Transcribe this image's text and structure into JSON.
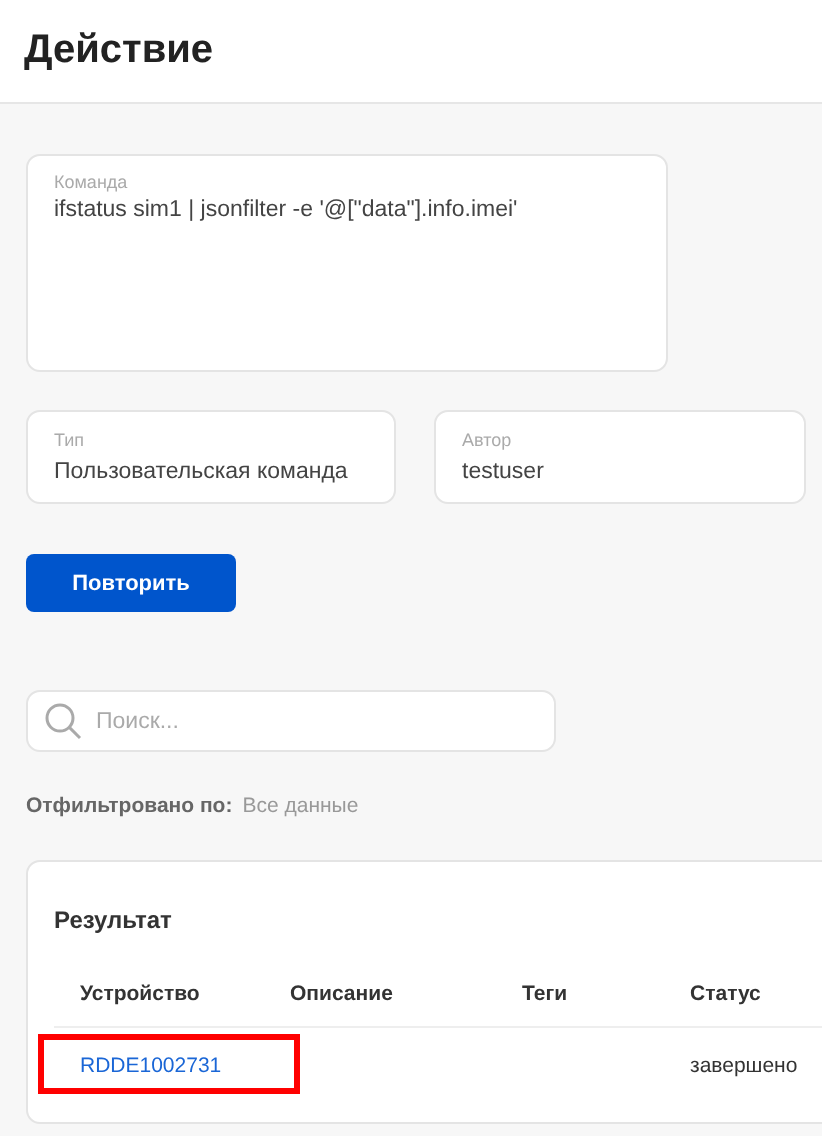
{
  "header": {
    "title": "Действие"
  },
  "command": {
    "label": "Команда",
    "value": "ifstatus sim1 | jsonfilter -e '@[\"data\"].info.imei'"
  },
  "fields": [
    {
      "label": "Тип",
      "value": "Пользовательская команда"
    },
    {
      "label": "Автор",
      "value": "testuser"
    }
  ],
  "repeat_button": "Повторить",
  "search": {
    "placeholder": "Поиск..."
  },
  "filter": {
    "label": "Отфильтровано по:",
    "value": "Все данные"
  },
  "result": {
    "title": "Результат",
    "columns": [
      "Устройство",
      "Описание",
      "Теги",
      "Статус"
    ],
    "rows": [
      {
        "device": "RDDE1002731",
        "description": "",
        "tags": "",
        "status": "завершено",
        "highlighted": true
      }
    ]
  }
}
